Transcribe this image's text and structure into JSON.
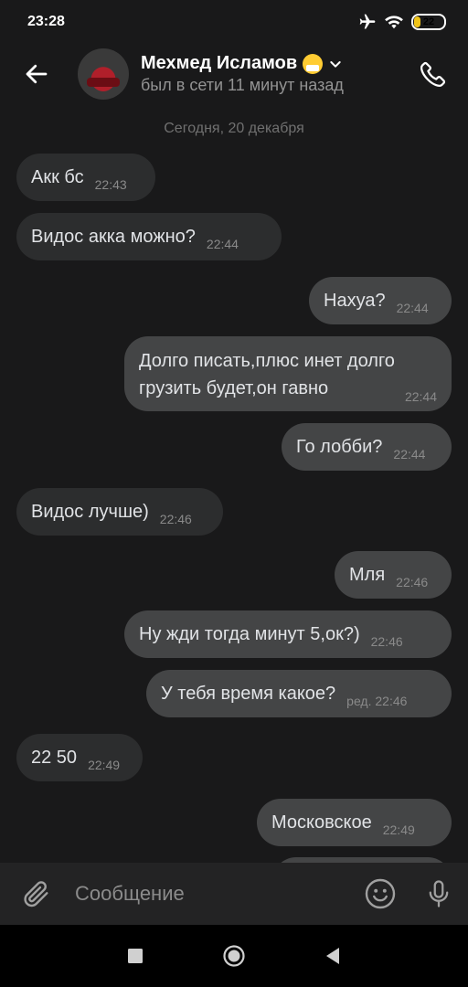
{
  "status": {
    "time": "23:28",
    "battery": "22",
    "battery_level": 0.22
  },
  "header": {
    "name": "Мехмед Исламов",
    "last_seen": "был в сети 11 минут назад"
  },
  "messages": {
    "date_separator": "Сегодня, 20 декабря",
    "items": [
      {
        "text": "Акк бс",
        "time": "22:43",
        "direction": "in"
      },
      {
        "text": "Видос акка можно?",
        "time": "22:44",
        "direction": "in"
      },
      {
        "text": "Нахуа?",
        "time": "22:44",
        "direction": "out"
      },
      {
        "text": "Долго писать,плюс инет долго грузить будет,он гавно",
        "time": "22:44",
        "direction": "out"
      },
      {
        "text": "Го лобби?",
        "time": "22:44",
        "direction": "out"
      },
      {
        "text": "Видос лучше)",
        "time": "22:46",
        "direction": "in"
      },
      {
        "text": "Мля",
        "time": "22:46",
        "direction": "out"
      },
      {
        "text": "Ну жди тогда минут 5,ок?)",
        "time": "22:46",
        "direction": "out"
      },
      {
        "text": "У тебя время какое?",
        "time": "ред. 22:46",
        "direction": "out"
      },
      {
        "text": "22 50",
        "time": "22:49",
        "direction": "in"
      },
      {
        "text": "Московское",
        "time": "22:49",
        "direction": "out"
      }
    ]
  },
  "input": {
    "placeholder": "Сообщение"
  },
  "icons": {
    "back": "arrow-left-icon",
    "chevron": "chevron-down-icon",
    "call": "phone-icon",
    "attach": "paperclip-icon",
    "emoji": "smiley-icon",
    "mic": "microphone-icon",
    "airplane": "airplane-icon",
    "wifi": "wifi-icon"
  },
  "colors": {
    "background": "#19191a",
    "bubble_in": "#2c2d2e",
    "bubble_out": "#444546",
    "battery": "#f0c419"
  }
}
